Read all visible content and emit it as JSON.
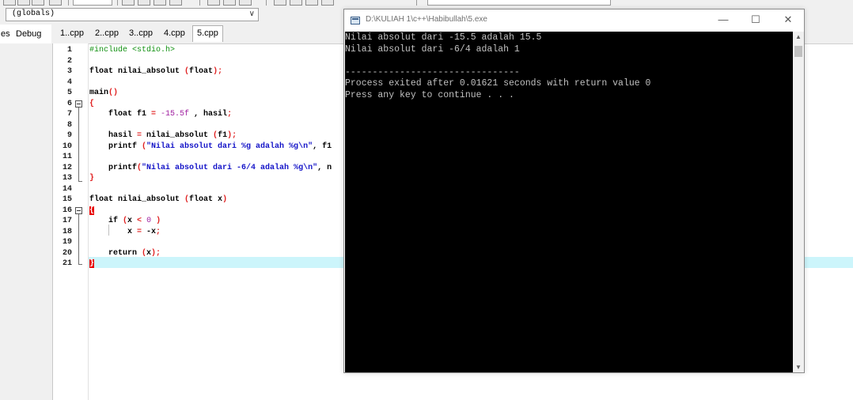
{
  "ide": {
    "scope_selector": "(globals)",
    "panel_tabs": [
      "es",
      "Debug"
    ],
    "file_tabs": [
      "1..cpp",
      "2..cpp",
      "3..cpp",
      "4.cpp",
      "5.cpp"
    ],
    "active_tab": "5.cpp",
    "line_numbers": [
      "1",
      "2",
      "3",
      "4",
      "5",
      "6",
      "7",
      "8",
      "9",
      "10",
      "11",
      "12",
      "13",
      "14",
      "15",
      "16",
      "17",
      "18",
      "19",
      "20",
      "21"
    ]
  },
  "code": {
    "l1": "#include <stdio.h>",
    "l3_a": "float nilai_absolut ",
    "l3_b": "(",
    "l3_c": "float",
    "l3_d": ");",
    "l5_a": "main",
    "l5_b": "()",
    "l6": "{",
    "l7_a": "    float f1 ",
    "l7_b": "=",
    "l7_c": " -15.5f",
    "l7_d": " , hasil",
    "l7_e": ";",
    "l9_a": "    hasil ",
    "l9_b": "=",
    "l9_c": " nilai_absolut ",
    "l9_d": "(",
    "l9_e": "f1",
    "l9_f": ");",
    "l10_a": "    printf ",
    "l10_b": "(",
    "l10_c": "\"Nilai absolut dari %g adalah %g\\n\"",
    "l10_d": ", f1",
    "l12_a": "    printf",
    "l12_b": "(",
    "l12_c": "\"Nilai absolut dari -6/4 adalah %g\\n\"",
    "l12_d": ", n",
    "l13": "}",
    "l15_a": "float nilai_absolut ",
    "l15_b": "(",
    "l15_c": "float x",
    "l15_d": ")",
    "l16": "{",
    "l17_a": "    if ",
    "l17_b": "(",
    "l17_c": "x ",
    "l17_d": "<",
    "l17_e": " 0 ",
    "l17_f": ")",
    "l18_a": "        x ",
    "l18_b": "=",
    "l18_c": " -x",
    "l18_d": ";",
    "l20_a": "    return ",
    "l20_b": "(",
    "l20_c": "x",
    "l20_d": ");",
    "l21": "}"
  },
  "console": {
    "title": "D:\\KULIAH 1\\c++\\Habibullah\\5.exe",
    "minimize": "—",
    "maximize": "☐",
    "close": "✕",
    "lines": [
      "Nilai absolut dari -15.5 adalah 15.5",
      "Nilai absolut dari -6/4 adalah 1",
      "",
      "--------------------------------",
      "Process exited after 0.01621 seconds with return value 0",
      "Press any key to continue . . ."
    ],
    "scroll_up": "▲",
    "scroll_down": "▼"
  },
  "colors": {
    "highlight_line": "#ccf5fb",
    "brace_match": "#e80000",
    "string": "#1414c8",
    "number": "#a020a0",
    "preprocessor": "#109010",
    "symbol": "#e02020"
  }
}
